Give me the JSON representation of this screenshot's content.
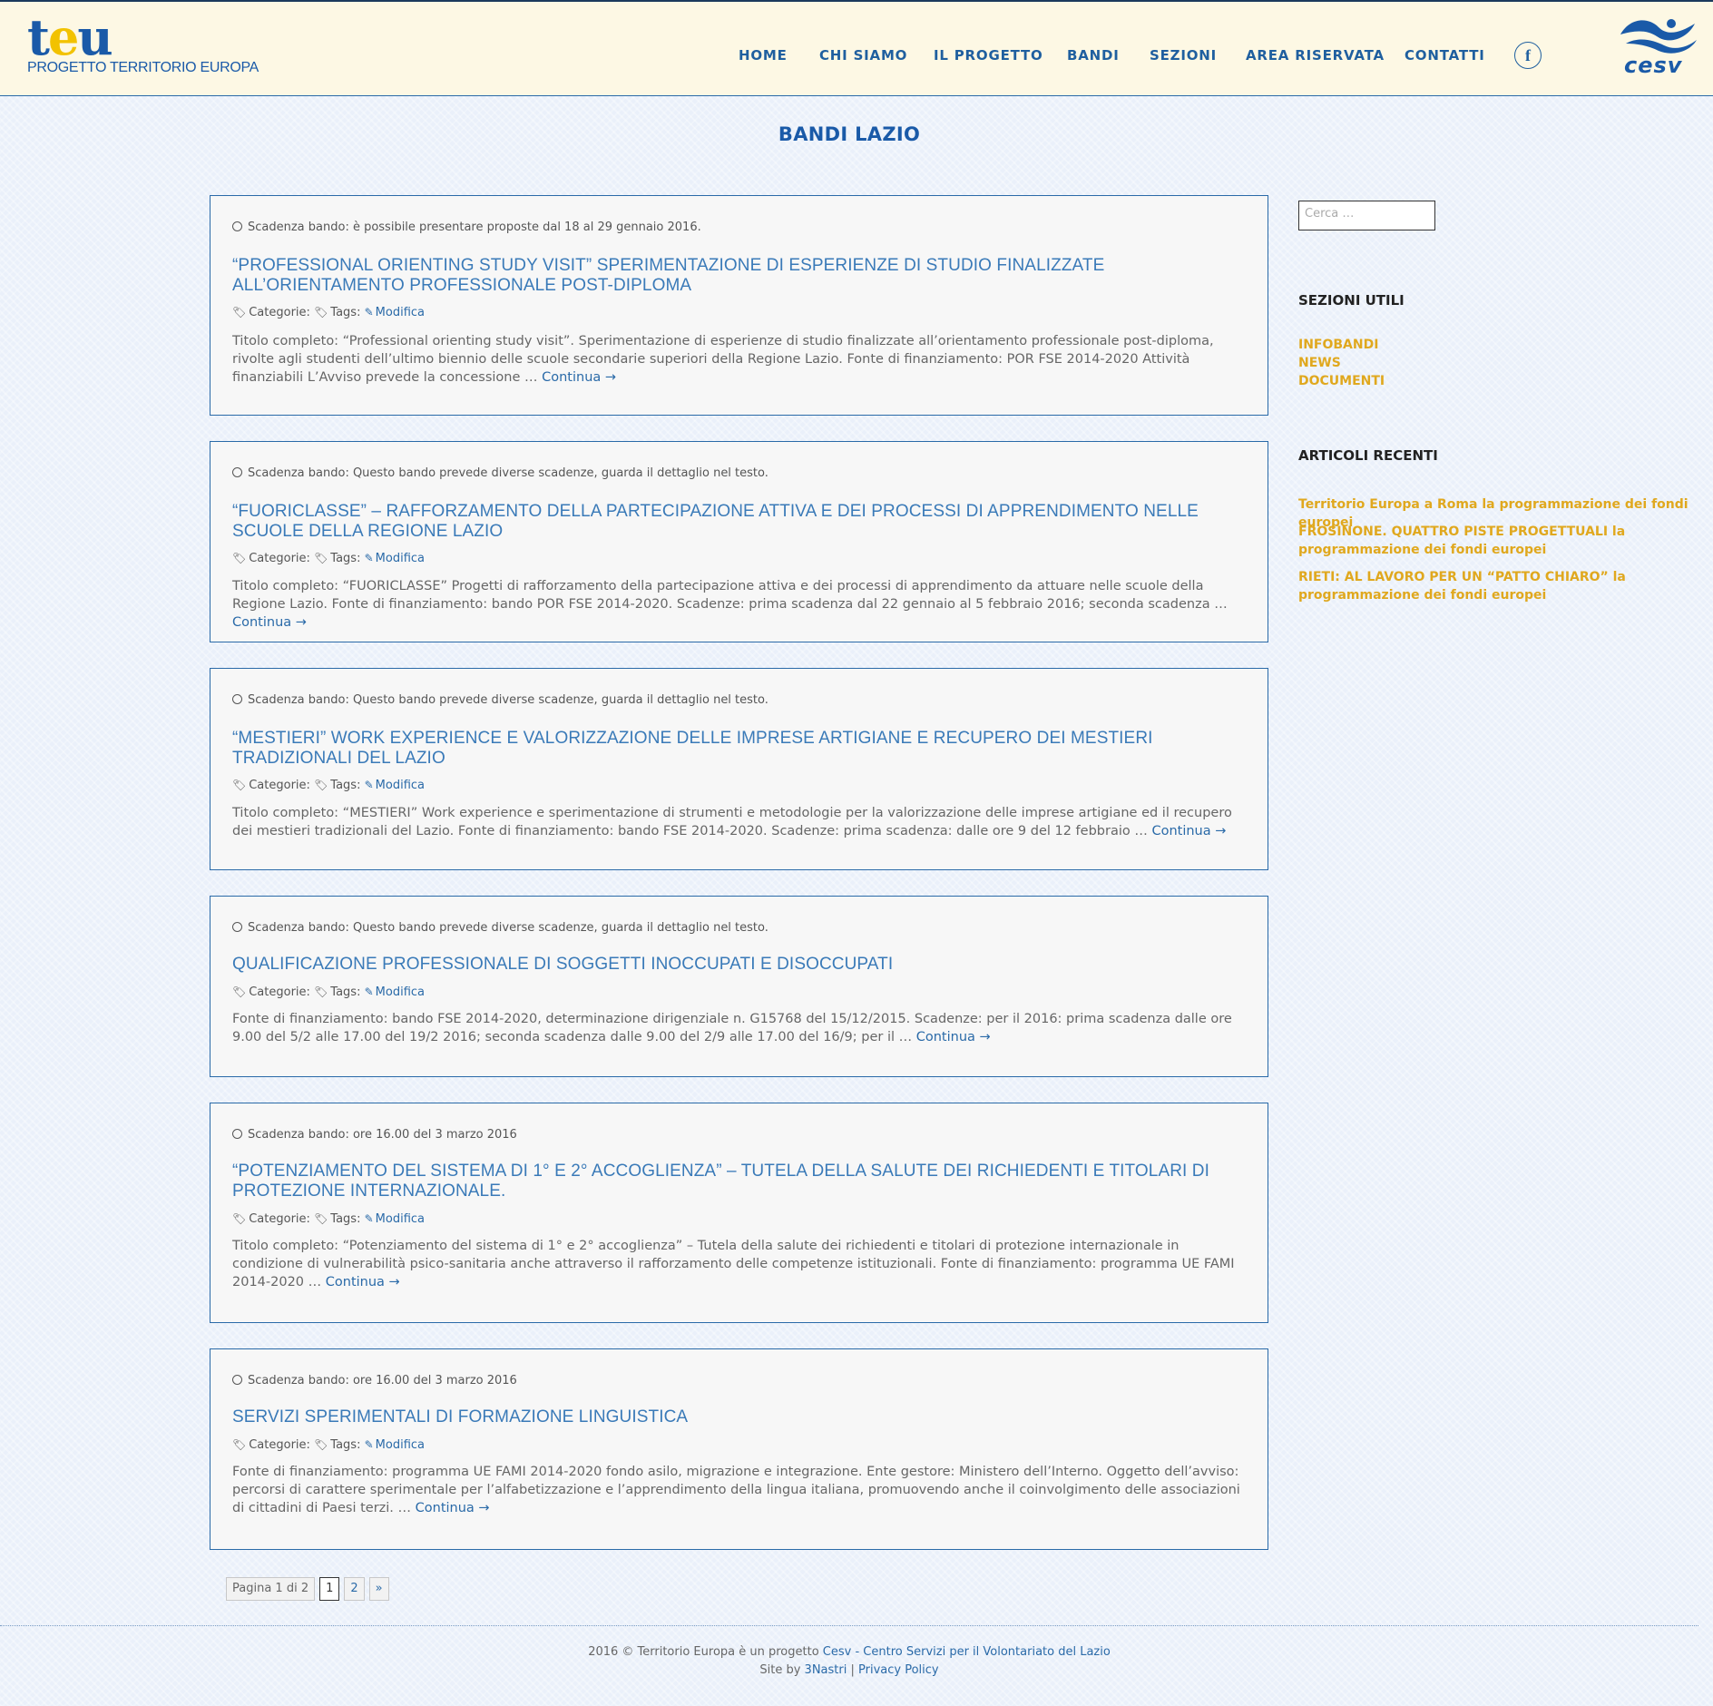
{
  "brand": {
    "logo_mark_t": "t",
    "logo_mark_e": "e",
    "logo_mark_u": "u",
    "logo_sub": "PROGETTO TERRITORIO EUROPA",
    "partner_logo": "cesv"
  },
  "nav": {
    "home": "HOME",
    "chi_siamo": "CHI SIAMO",
    "il_progetto": "IL PROGETTO",
    "bandi": "BANDI",
    "sezioni": "SEZIONI",
    "area_riservata": "AREA RISERVATA",
    "contatti": "CONTATTI",
    "facebook_glyph": "f"
  },
  "page_title": "BANDI LAZIO",
  "common": {
    "categorie": "Categorie:",
    "tags": "Tags:",
    "modifica": "Modifica",
    "continua": "Continua →"
  },
  "posts": [
    {
      "date": "Scadenza bando: è possibile presentare proposte dal 18 al 29 gennaio 2016.",
      "title": "“PROFESSIONAL ORIENTING STUDY VISIT” SPERIMENTAZIONE DI ESPERIENZE DI STUDIO FINALIZZATE ALL’ORIENTAMENTO PROFESSIONALE POST-DIPLOMA",
      "excerpt": "  Titolo completo: “Professional orienting study visit”. Sperimentazione di esperienze di studio finalizzate all’orientamento professionale post-diploma, rivolte agli studenti dell’ultimo biennio delle scuole secondarie superiori della Regione Lazio.  Fonte di finanziamento: POR FSE 2014-2020  Attività finanziabili L’Avviso prevede la concessione … "
    },
    {
      "date": "Scadenza bando: Questo bando prevede diverse scadenze, guarda il dettaglio nel testo.",
      "title": " “FUORICLASSE” – RAFFORZAMENTO DELLA PARTECIPAZIONE ATTIVA E DEI PROCESSI DI APPRENDIMENTO NELLE SCUOLE DELLA REGIONE LAZIO",
      "excerpt": "Titolo completo: “FUORICLASSE” Progetti di rafforzamento della partecipazione attiva e dei processi di apprendimento da attuare nelle scuole della Regione Lazio. Fonte di finanziamento: bando POR FSE 2014-2020.  Scadenze: prima scadenza dal 22 gennaio al 5 febbraio 2016; seconda scadenza … "
    },
    {
      "date": "Scadenza bando: Questo bando prevede diverse scadenze, guarda il dettaglio nel testo.",
      "title": "“MESTIERI” WORK EXPERIENCE E VALORIZZAZIONE DELLE IMPRESE ARTIGIANE E RECUPERO DEI MESTIERI TRADIZIONALI DEL LAZIO",
      "excerpt": "Titolo completo: “MESTIERI” Work experience e sperimentazione di strumenti e metodologie per la valorizzazione delle imprese artigiane ed il recupero dei mestieri tradizionali del Lazio. Fonte di finanziamento: bando FSE 2014-2020.  Scadenze: prima scadenza: dalle ore 9 del 12 febbraio … "
    },
    {
      "date": "Scadenza bando: Questo bando prevede diverse scadenze, guarda il dettaglio nel testo.",
      "title": "QUALIFICAZIONE PROFESSIONALE DI SOGGETTI INOCCUPATI E DISOCCUPATI",
      "excerpt": "Fonte di finanziamento: bando FSE 2014-2020, determinazione dirigenziale n. G15768 del 15/12/2015.  Scadenze: per il 2016: prima scadenza dalle ore 9.00 del 5/2 alle 17.00 del 19/2 2016; seconda scadenza dalle 9.00 del 2/9 alle 17.00 del 16/9; per il … "
    },
    {
      "date": "Scadenza bando: ore 16.00 del 3 marzo 2016",
      "title": "“POTENZIAMENTO DEL SISTEMA DI 1° E 2° ACCOGLIENZA” – TUTELA DELLA SALUTE DEI RICHIEDENTI E TITOLARI DI PROTEZIONE INTERNAZIONALE.",
      "excerpt": "Titolo completo: “Potenziamento del sistema di 1° e 2° accoglienza” – Tutela della salute dei richiedenti e titolari di protezione internazionale in condizione di vulnerabilità psico-sanitaria anche attraverso il rafforzamento delle competenze istituzionali. Fonte di finanziamento: programma UE FAMI 2014-2020 … "
    },
    {
      "date": "Scadenza bando: ore 16.00 del 3 marzo 2016",
      "title": "SERVIZI SPERIMENTALI DI FORMAZIONE LINGUISTICA",
      "excerpt": "Fonte di finanziamento: programma UE FAMI 2014-2020 fondo asilo, migrazione e integrazione. Ente gestore: Ministero dell’Interno. Oggetto dell’avviso: percorsi di carattere sperimentale per l’alfabetizzazione e l’apprendimento della lingua italiana, promuovendo anche il coinvolgimento delle associazioni di cittadini di Paesi terzi. … "
    }
  ],
  "pagination": {
    "info": "Pagina 1 di 2",
    "current": "1",
    "next_page": "2",
    "next": "»"
  },
  "sidebar": {
    "search_placeholder": "Cerca …",
    "sezioni_title": "SEZIONI UTILI",
    "sezioni": [
      "INFOBANDI",
      "NEWS",
      "DOCUMENTI"
    ],
    "recent_title": "ARTICOLI RECENTI",
    "recent": [
      "Territorio Europa a Roma la programmazione dei fondi europei",
      "FROSINONE. QUATTRO PISTE PROGETTUALI la programmazione dei fondi europei",
      "RIETI: AL LAVORO PER UN “PATTO CHIARO” la programmazione dei fondi europei"
    ]
  },
  "footer": {
    "copyright": "2016 © Territorio Europa è un progetto ",
    "cesv_link": "Cesv - Centro Servizi per il Volontariato del Lazio",
    "site_by": "Site by ",
    "nastri_link": "3Nastri",
    "sep": " | ",
    "privacy_link": "Privacy Policy"
  },
  "colors": {
    "accent": "#1a5aa8",
    "link": "#2a6aa8",
    "sidebar_link": "#e0a81e",
    "header_bg": "#fdf8e4"
  },
  "icons": {
    "date": "clock-icon",
    "categories": "tag-icon",
    "tags": "tag-icon",
    "edit": "pencil-icon",
    "social": "facebook-icon"
  }
}
